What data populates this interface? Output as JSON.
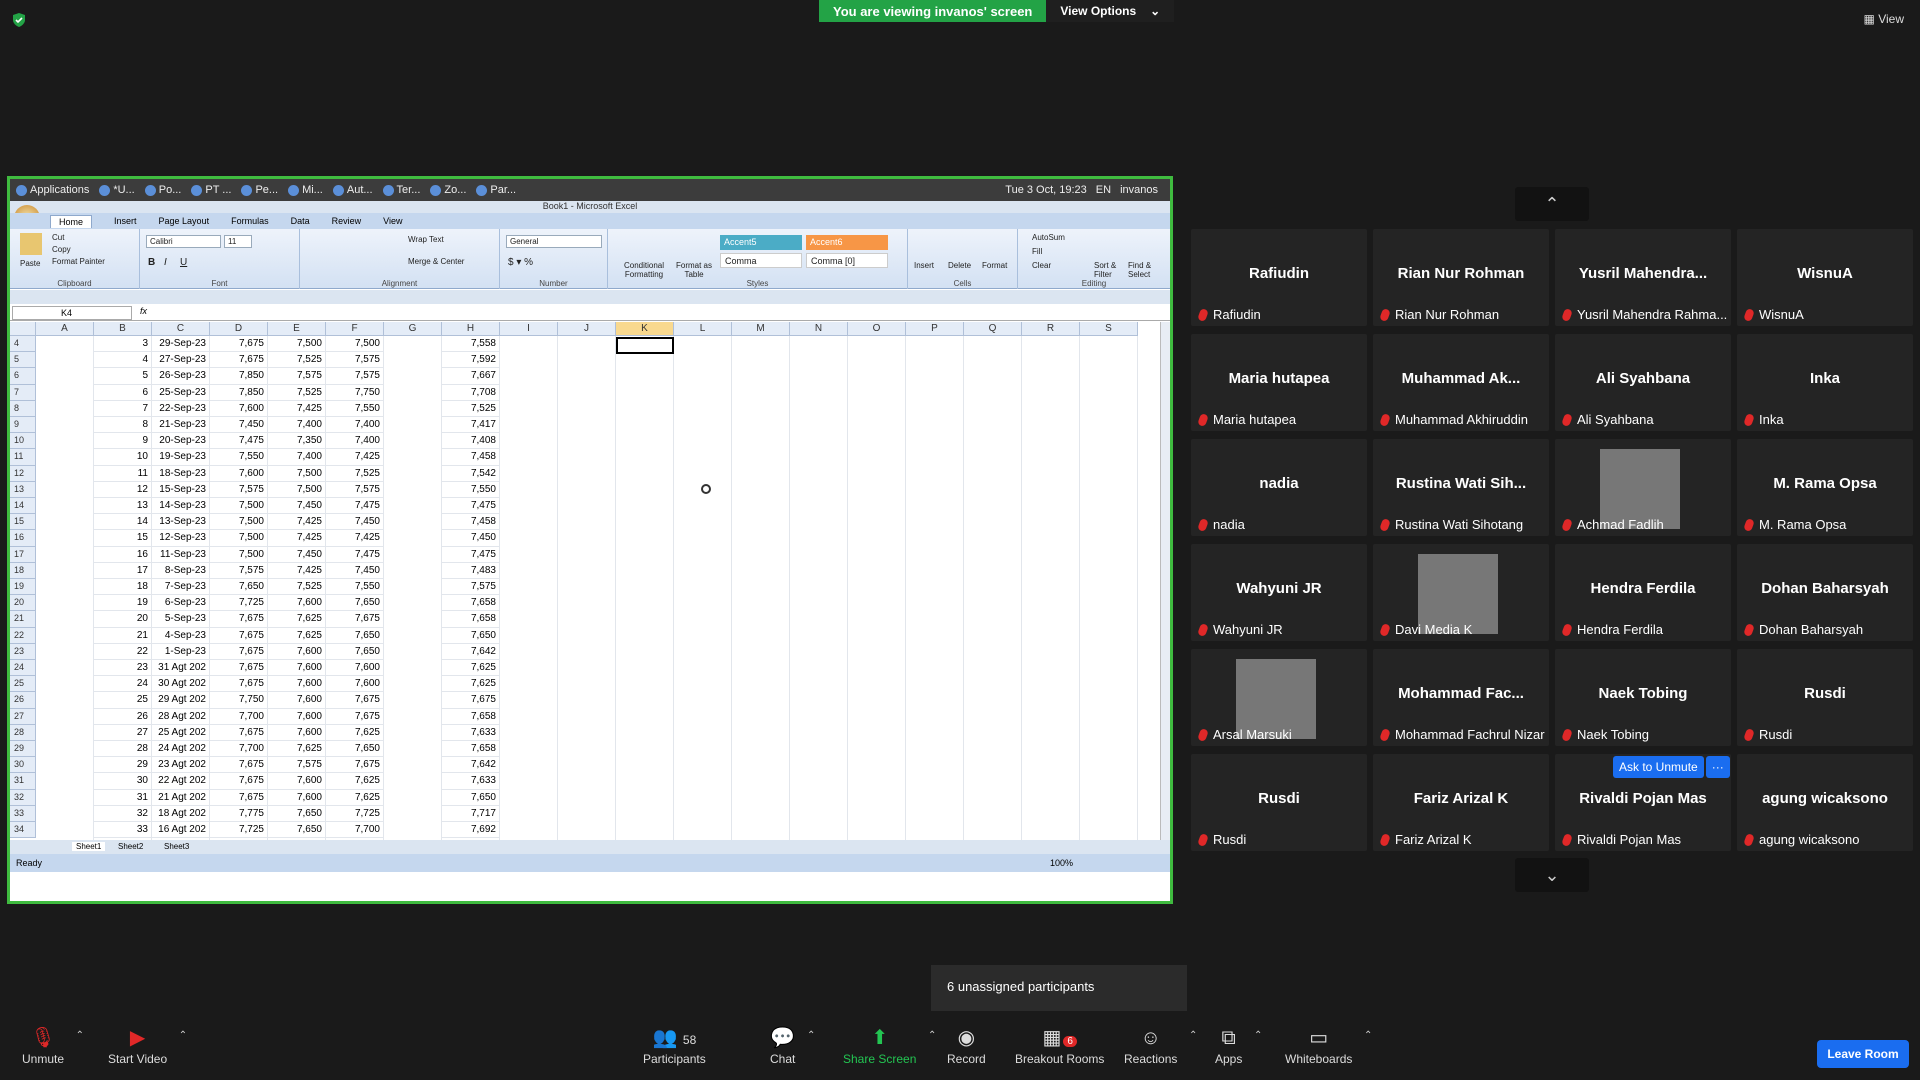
{
  "banner": {
    "viewing": "You are viewing invanos' screen",
    "view_options": "View Options"
  },
  "top_right_view": "View",
  "taskbar": {
    "items": [
      "Applications",
      "*U...",
      "Po...",
      "PT ...",
      "Pe...",
      "Mi...",
      "Aut...",
      "Ter...",
      "Zo...",
      "Par..."
    ],
    "clock": "Tue  3 Oct, 19:23",
    "lang": "EN",
    "user": "invanos"
  },
  "excel": {
    "title": "Book1 - Microsoft Excel",
    "tabs": [
      "Home",
      "Insert",
      "Page Layout",
      "Formulas",
      "Data",
      "Review",
      "View"
    ],
    "ribbon": {
      "paste": "Paste",
      "cut": "Cut",
      "copy": "Copy",
      "format_painter": "Format Painter",
      "clipboard": "Clipboard",
      "font_name": "Calibri",
      "font_size": "11",
      "font": "Font",
      "wrap": "Wrap Text",
      "merge": "Merge & Center",
      "alignment": "Alignment",
      "number_format": "General",
      "number": "Number",
      "cond": "Conditional Formatting",
      "fmt_table": "Format as Table",
      "accent5": "Accent5",
      "accent6": "Accent6",
      "comma": "Comma",
      "comma0": "Comma [0]",
      "styles": "Styles",
      "insert": "Insert",
      "delete": "Delete",
      "format": "Format",
      "cells": "Cells",
      "autosum": "AutoSum",
      "fill": "Fill",
      "clear": "Clear",
      "sort": "Sort & Filter",
      "find": "Find & Select",
      "editing": "Editing"
    },
    "name_box": "K4",
    "fx": "fx",
    "columns": [
      "A",
      "B",
      "C",
      "D",
      "E",
      "F",
      "G",
      "H",
      "I",
      "J",
      "K",
      "L",
      "M",
      "N",
      "O",
      "P",
      "Q",
      "R",
      "S"
    ],
    "rows": [
      [
        "4",
        "3",
        "29-Sep-23",
        "7,675",
        "7,500",
        "7,500",
        "7,558"
      ],
      [
        "5",
        "4",
        "27-Sep-23",
        "7,675",
        "7,525",
        "7,575",
        "7,592"
      ],
      [
        "6",
        "5",
        "26-Sep-23",
        "7,850",
        "7,575",
        "7,575",
        "7,667"
      ],
      [
        "7",
        "6",
        "25-Sep-23",
        "7,850",
        "7,525",
        "7,750",
        "7,708"
      ],
      [
        "8",
        "7",
        "22-Sep-23",
        "7,600",
        "7,425",
        "7,550",
        "7,525"
      ],
      [
        "9",
        "8",
        "21-Sep-23",
        "7,450",
        "7,400",
        "7,400",
        "7,417"
      ],
      [
        "10",
        "9",
        "20-Sep-23",
        "7,475",
        "7,350",
        "7,400",
        "7,408"
      ],
      [
        "11",
        "10",
        "19-Sep-23",
        "7,550",
        "7,400",
        "7,425",
        "7,458"
      ],
      [
        "12",
        "11",
        "18-Sep-23",
        "7,600",
        "7,500",
        "7,525",
        "7,542"
      ],
      [
        "13",
        "12",
        "15-Sep-23",
        "7,575",
        "7,500",
        "7,575",
        "7,550"
      ],
      [
        "14",
        "13",
        "14-Sep-23",
        "7,500",
        "7,450",
        "7,475",
        "7,475"
      ],
      [
        "15",
        "14",
        "13-Sep-23",
        "7,500",
        "7,425",
        "7,450",
        "7,458"
      ],
      [
        "16",
        "15",
        "12-Sep-23",
        "7,500",
        "7,425",
        "7,425",
        "7,450"
      ],
      [
        "17",
        "16",
        "11-Sep-23",
        "7,500",
        "7,450",
        "7,475",
        "7,475"
      ],
      [
        "18",
        "17",
        "8-Sep-23",
        "7,575",
        "7,425",
        "7,450",
        "7,483"
      ],
      [
        "19",
        "18",
        "7-Sep-23",
        "7,650",
        "7,525",
        "7,550",
        "7,575"
      ],
      [
        "20",
        "19",
        "6-Sep-23",
        "7,725",
        "7,600",
        "7,650",
        "7,658"
      ],
      [
        "21",
        "20",
        "5-Sep-23",
        "7,675",
        "7,625",
        "7,675",
        "7,658"
      ],
      [
        "22",
        "21",
        "4-Sep-23",
        "7,675",
        "7,625",
        "7,650",
        "7,650"
      ],
      [
        "23",
        "22",
        "1-Sep-23",
        "7,675",
        "7,600",
        "7,650",
        "7,642"
      ],
      [
        "24",
        "23",
        "31 Agt 202",
        "7,675",
        "7,600",
        "7,600",
        "7,625"
      ],
      [
        "25",
        "24",
        "30 Agt 202",
        "7,675",
        "7,600",
        "7,600",
        "7,625"
      ],
      [
        "26",
        "25",
        "29 Agt 202",
        "7,750",
        "7,600",
        "7,675",
        "7,675"
      ],
      [
        "27",
        "26",
        "28 Agt 202",
        "7,700",
        "7,600",
        "7,675",
        "7,658"
      ],
      [
        "28",
        "27",
        "25 Agt 202",
        "7,675",
        "7,600",
        "7,625",
        "7,633"
      ],
      [
        "29",
        "28",
        "24 Agt 202",
        "7,700",
        "7,625",
        "7,650",
        "7,658"
      ],
      [
        "30",
        "29",
        "23 Agt 202",
        "7,675",
        "7,575",
        "7,675",
        "7,642"
      ],
      [
        "31",
        "30",
        "22 Agt 202",
        "7,675",
        "7,600",
        "7,625",
        "7,633"
      ],
      [
        "32",
        "31",
        "21 Agt 202",
        "7,675",
        "7,600",
        "7,625",
        "7,650"
      ],
      [
        "33",
        "32",
        "18 Agt 202",
        "7,775",
        "7,650",
        "7,725",
        "7,717"
      ],
      [
        "34",
        "33",
        "16 Agt 202",
        "7,725",
        "7,650",
        "7,700",
        "7,692"
      ]
    ],
    "sheets": [
      "Sheet1",
      "Sheet2",
      "Sheet3"
    ],
    "status": "Ready",
    "zoom": "100%"
  },
  "participants_grid": [
    {
      "display": "Rafiudin",
      "label": "Rafiudin"
    },
    {
      "display": "Rian Nur Rohman",
      "label": "Rian Nur Rohman"
    },
    {
      "display": "Yusril  Mahendra...",
      "label": "Yusril Mahendra Rahma..."
    },
    {
      "display": "WisnuA",
      "label": "WisnuA"
    },
    {
      "display": "Maria hutapea",
      "label": "Maria hutapea"
    },
    {
      "display": "Muhammad  Ak...",
      "label": "Muhammad Akhiruddin"
    },
    {
      "display": "Ali Syahbana",
      "label": "Ali Syahbana"
    },
    {
      "display": "Inka",
      "label": "Inka"
    },
    {
      "display": "nadia",
      "label": "nadia"
    },
    {
      "display": "Rustina  Wati  Sih...",
      "label": "Rustina Wati Sihotang"
    },
    {
      "display": "",
      "label": "Achmad Fadlih",
      "photo": true
    },
    {
      "display": "M. Rama Opsa",
      "label": "M. Rama Opsa"
    },
    {
      "display": "Wahyuni JR",
      "label": "Wahyuni JR"
    },
    {
      "display": "",
      "label": "Davi Media K",
      "photo": true
    },
    {
      "display": "Hendra Ferdila",
      "label": "Hendra Ferdila"
    },
    {
      "display": "Dohan Baharsyah",
      "label": "Dohan Baharsyah"
    },
    {
      "display": "",
      "label": "Arsal Marsuki",
      "photo": true
    },
    {
      "display": "Mohammad  Fac...",
      "label": "Mohammad Fachrul Nizar"
    },
    {
      "display": "Naek Tobing",
      "label": "Naek Tobing"
    },
    {
      "display": "Rusdi",
      "label": "Rusdi"
    },
    {
      "display": "Rusdi",
      "label": "Rusdi"
    },
    {
      "display": "Fariz Arizal K",
      "label": "Fariz Arizal K"
    },
    {
      "display": "Rivaldi Pojan Mas",
      "label": "Rivaldi Pojan Mas"
    },
    {
      "display": "agung wicaksono",
      "label": "agung wicaksono"
    }
  ],
  "ask_to_unmute": "Ask to Unmute",
  "more": "···",
  "unassigned": "6 unassigned participants",
  "toolbar": {
    "unmute": "Unmute",
    "start_video": "Start Video",
    "participants": "Participants",
    "participants_count": "58",
    "chat": "Chat",
    "share": "Share Screen",
    "record": "Record",
    "breakout": "Breakout Rooms",
    "breakout_badge": "6",
    "reactions": "Reactions",
    "apps": "Apps",
    "whiteboards": "Whiteboards",
    "leave": "Leave Room"
  },
  "colors": {
    "share_green": "#23a346",
    "accent_blue": "#1a6df0",
    "mic_red": "#e02828"
  }
}
